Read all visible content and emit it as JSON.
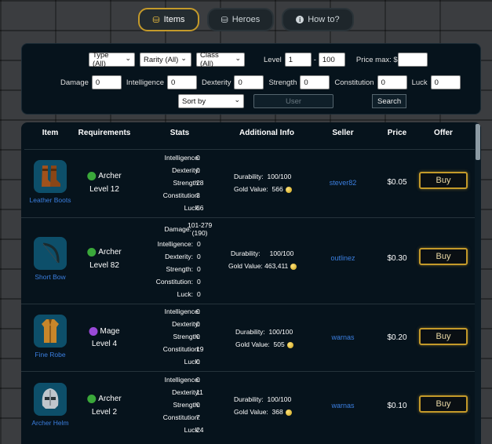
{
  "tabs": [
    {
      "label": "Items",
      "icon": "coins-icon",
      "active": true
    },
    {
      "label": "Heroes",
      "icon": "coins-icon",
      "active": false
    },
    {
      "label": "How to?",
      "icon": "info-icon",
      "active": false
    }
  ],
  "filters": {
    "type": "Type (All)",
    "rarity": "Rarity (All)",
    "class": "Class (All)",
    "level_label": "Level",
    "level_min": "1",
    "level_dash": "-",
    "level_max": "100",
    "price_label": "Price max: $",
    "price_value": "",
    "damage_label": "Damage",
    "damage_value": "0",
    "intelligence_label": "Intelligence",
    "intelligence_value": "0",
    "dexterity_label": "Dexterity",
    "dexterity_value": "0",
    "strength_label": "Strength",
    "strength_value": "0",
    "constitution_label": "Constitution",
    "constitution_value": "0",
    "luck_label": "Luck",
    "luck_value": "0",
    "sort": "Sort by",
    "user_placeholder": "User",
    "search": "Search"
  },
  "columns": {
    "item": "Item",
    "requirements": "Requirements",
    "stats": "Stats",
    "info": "Additional Info",
    "seller": "Seller",
    "price": "Price",
    "offer": "Offer"
  },
  "rows": [
    {
      "name": "Leather Boots",
      "class": "Archer",
      "class_color": "#3aa83a",
      "level": "Level 12",
      "stats": [
        {
          "label": "Intelligence:",
          "value": "0"
        },
        {
          "label": "Dexterity:",
          "value": "0"
        },
        {
          "label": "Strength:",
          "value": "28"
        },
        {
          "label": "Constitution:",
          "value": "3"
        },
        {
          "label": "Luck:",
          "value": "56"
        }
      ],
      "durability_label": "Durability:",
      "durability": "100/100",
      "gold_label": "Gold Value:",
      "gold": "566",
      "seller": "stever82",
      "price": "$0.05",
      "buy": "Buy"
    },
    {
      "name": "Short Bow",
      "class": "Archer",
      "class_color": "#3aa83a",
      "level": "Level 82",
      "damage_label": "Damage:",
      "damage_range": "101-279",
      "damage_avg": "(190)",
      "stats": [
        {
          "label": "Intelligence:",
          "value": "0"
        },
        {
          "label": "Dexterity:",
          "value": "0"
        },
        {
          "label": "Strength:",
          "value": "0"
        },
        {
          "label": "Constitution:",
          "value": "0"
        },
        {
          "label": "Luck:",
          "value": "0"
        }
      ],
      "durability_label": "Durability:",
      "durability": "100/100",
      "gold_label": "Gold Value:",
      "gold": "463,411",
      "seller": "outlinez",
      "price": "$0.30",
      "buy": "Buy"
    },
    {
      "name": "Fine Robe",
      "class": "Mage",
      "class_color": "#9a4ad8",
      "level": "Level 4",
      "stats": [
        {
          "label": "Intelligence:",
          "value": "0"
        },
        {
          "label": "Dexterity:",
          "value": "0"
        },
        {
          "label": "Strength:",
          "value": "0"
        },
        {
          "label": "Constitution:",
          "value": "19"
        },
        {
          "label": "Luck:",
          "value": "0"
        }
      ],
      "durability_label": "Durability:",
      "durability": "100/100",
      "gold_label": "Gold Value:",
      "gold": "505",
      "seller": "warnas",
      "price": "$0.20",
      "buy": "Buy"
    },
    {
      "name": "Archer Helm",
      "class": "Archer",
      "class_color": "#3aa83a",
      "level": "Level 2",
      "stats": [
        {
          "label": "Intelligence:",
          "value": "0"
        },
        {
          "label": "Dexterity:",
          "value": "11"
        },
        {
          "label": "Strength:",
          "value": "0"
        },
        {
          "label": "Constitution:",
          "value": "7"
        },
        {
          "label": "Luck:",
          "value": "24"
        }
      ],
      "durability_label": "Durability:",
      "durability": "100/100",
      "gold_label": "Gold Value:",
      "gold": "368",
      "seller": "warnas",
      "price": "$0.10",
      "buy": "Buy"
    }
  ]
}
